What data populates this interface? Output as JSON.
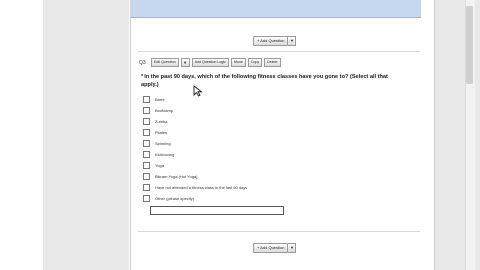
{
  "add_question": {
    "label": "+ Add Question",
    "arrow": "▼"
  },
  "question": {
    "number": "Q3",
    "toolbar": {
      "edit": "Edit Question",
      "logic": "Add Question Logic",
      "move": "Move",
      "copy": "Copy",
      "delete": "Delete",
      "arrow": "▼"
    },
    "required_marker": "*",
    "text": "In the past 90 days, which of the following fitness classes have you gone to? (Select all that apply.)",
    "options": [
      {
        "label": "Barre"
      },
      {
        "label": "Bootcamp"
      },
      {
        "label": "Zumba"
      },
      {
        "label": "Pilates"
      },
      {
        "label": "Spinning"
      },
      {
        "label": "Kickboxing"
      },
      {
        "label": "Yoga"
      },
      {
        "label": "Bikram Yoga (Hot Yoga)"
      },
      {
        "label": "Have not attended a fitness class in the last 90 days"
      },
      {
        "label": "Other (please specify)"
      }
    ],
    "other_value": ""
  },
  "colors": {
    "header": "#c5d8f0",
    "gutter": "#e8e8e8",
    "border": "#cfcfcf"
  }
}
